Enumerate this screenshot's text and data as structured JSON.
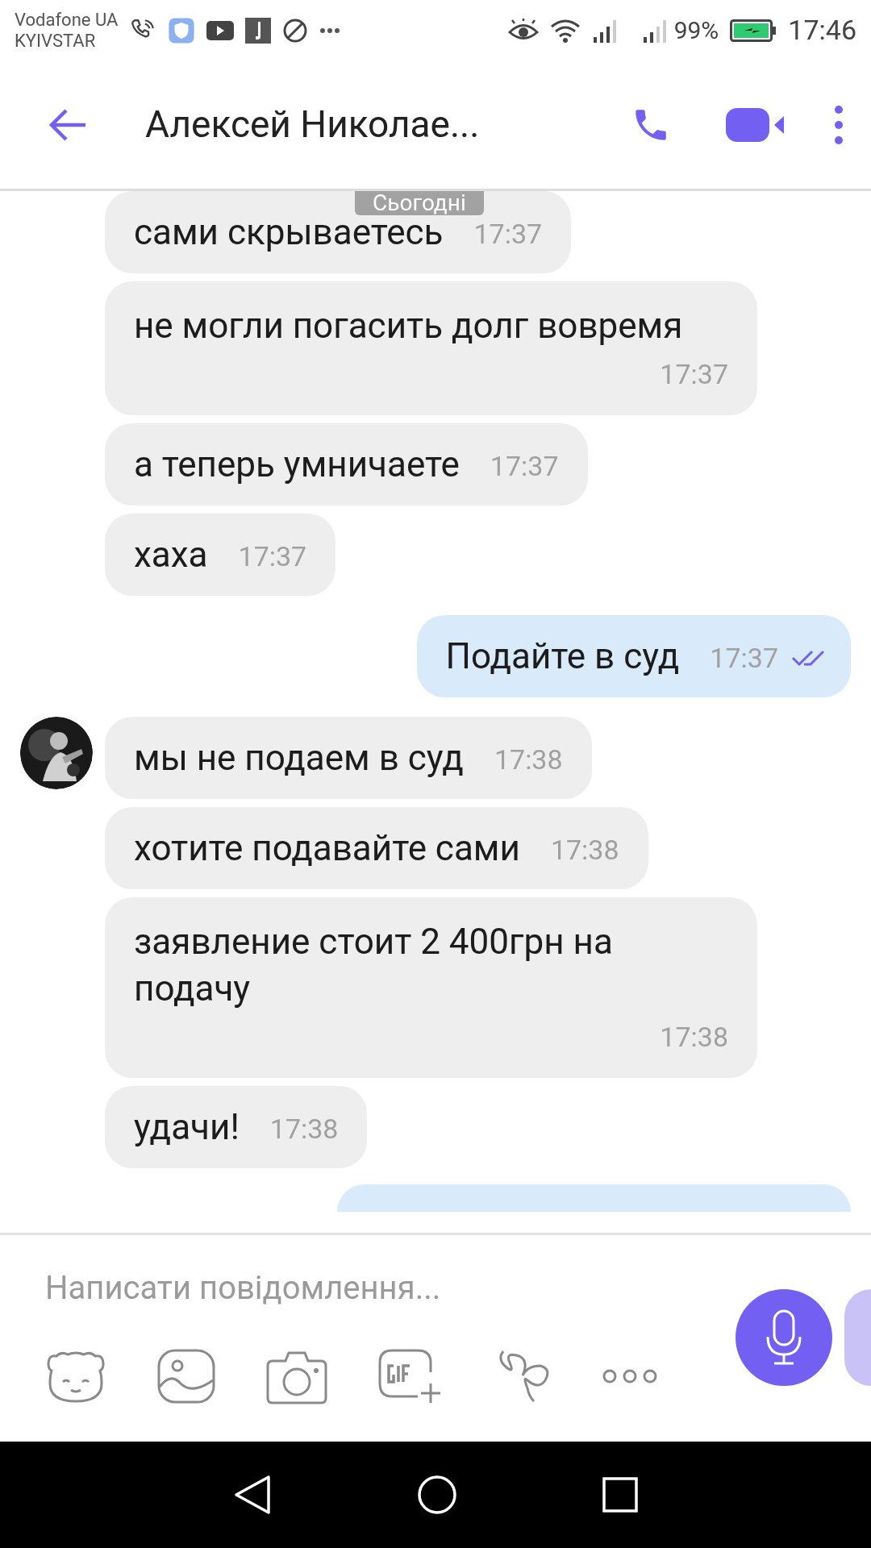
{
  "status_bar": {
    "carriers": [
      "Vodafone UA",
      "KYIVSTAR"
    ],
    "battery": "99%",
    "time": "17:46"
  },
  "header": {
    "title": "Алексей Николае..."
  },
  "date_badge": "Сьогодні",
  "messages": [
    {
      "kind": "incoming",
      "text": "сами скрываетесь",
      "time": "17:37",
      "avatar": false
    },
    {
      "kind": "incoming",
      "text": "не могли погасить долг вовремя",
      "time": "17:37",
      "avatar": false
    },
    {
      "kind": "incoming",
      "text": "а теперь умничаете",
      "time": "17:37",
      "avatar": false
    },
    {
      "kind": "incoming",
      "text": "хаха",
      "time": "17:37",
      "avatar": false
    },
    {
      "kind": "outgoing",
      "text": "Подайте в суд",
      "time": "17:37",
      "read": true
    },
    {
      "kind": "incoming",
      "text": "мы не подаем в суд",
      "time": "17:38",
      "avatar": true
    },
    {
      "kind": "incoming",
      "text": "хотите подавайте сами",
      "time": "17:38",
      "avatar": false
    },
    {
      "kind": "incoming",
      "text": "заявление стоит 2 400грн на подачу",
      "time": "17:38",
      "avatar": false
    },
    {
      "kind": "incoming",
      "text": "удачи!",
      "time": "17:38",
      "avatar": false
    },
    {
      "kind": "outgoing_partial"
    }
  ],
  "composer": {
    "placeholder": "Написати повідомлення..."
  }
}
